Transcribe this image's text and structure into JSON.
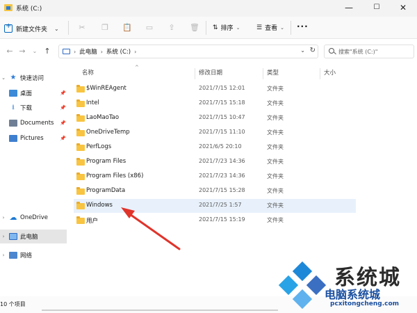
{
  "window": {
    "title": "系统 (C:)",
    "minimize": "—",
    "maximize": "☐",
    "close": "✕"
  },
  "toolbar": {
    "new_label": "新建文件夹",
    "new_caret": "⌄",
    "icons": [
      "scissors-icon",
      "copy-icon",
      "paste-icon",
      "rename-icon",
      "share-icon",
      "delete-icon"
    ],
    "sort_label": "排序",
    "view_label": "查看",
    "more_label": "···"
  },
  "address": {
    "back": "←",
    "forward": "→",
    "history": "⌄",
    "up": "↑",
    "breadcrumbs": [
      "此电脑",
      "系统 (C:)"
    ],
    "crumb_separator": "›",
    "dropdown": "⌄",
    "refresh": "↻"
  },
  "search": {
    "placeholder": "搜索\"系统 (C:)\""
  },
  "sidebar": {
    "items": [
      {
        "label": "快速访问",
        "chevron": "⌄",
        "pinned": false
      },
      {
        "label": "桌面",
        "chevron": "",
        "pinned": true
      },
      {
        "label": "下载",
        "chevron": "",
        "pinned": true
      },
      {
        "label": "Documents",
        "chevron": "",
        "pinned": true
      },
      {
        "label": "Pictures",
        "chevron": "",
        "pinned": true
      },
      {
        "label": "OneDrive",
        "chevron": "›",
        "pinned": false
      },
      {
        "label": "此电脑",
        "chevron": "›",
        "pinned": false,
        "selected": true
      },
      {
        "label": "网络",
        "chevron": "›",
        "pinned": false
      }
    ],
    "pin_glyph": "📌"
  },
  "columns": {
    "name": "名称",
    "date": "修改日期",
    "type": "类型",
    "size": "大小",
    "sort_indicator": "^"
  },
  "files": [
    {
      "name": "$WinREAgent",
      "date": "2021/7/15 12:01",
      "type": "文件夹"
    },
    {
      "name": "Intel",
      "date": "2021/7/15 15:18",
      "type": "文件夹"
    },
    {
      "name": "LaoMaoTao",
      "date": "2021/7/15 10:47",
      "type": "文件夹"
    },
    {
      "name": "OneDriveTemp",
      "date": "2021/7/15 11:10",
      "type": "文件夹"
    },
    {
      "name": "PerfLogs",
      "date": "2021/6/5 20:10",
      "type": "文件夹"
    },
    {
      "name": "Program Files",
      "date": "2021/7/23 14:36",
      "type": "文件夹"
    },
    {
      "name": "Program Files (x86)",
      "date": "2021/7/23 14:36",
      "type": "文件夹"
    },
    {
      "name": "ProgramData",
      "date": "2021/7/15 15:28",
      "type": "文件夹"
    },
    {
      "name": "Windows",
      "date": "2021/7/25 1:57",
      "type": "文件夹",
      "selected": true
    },
    {
      "name": "用户",
      "date": "2021/7/15 15:19",
      "type": "文件夹"
    }
  ],
  "status": {
    "item_count": "10 个项目"
  },
  "watermark": {
    "title": "系统城",
    "subtitle": "电脑系统城",
    "url": "pcxitongcheng.com",
    "colors": [
      "#1e88d8",
      "#2aa3e6",
      "#3a6fc2",
      "#5fb2ee"
    ]
  },
  "annotation": {
    "arrow_color": "#e0342b"
  }
}
